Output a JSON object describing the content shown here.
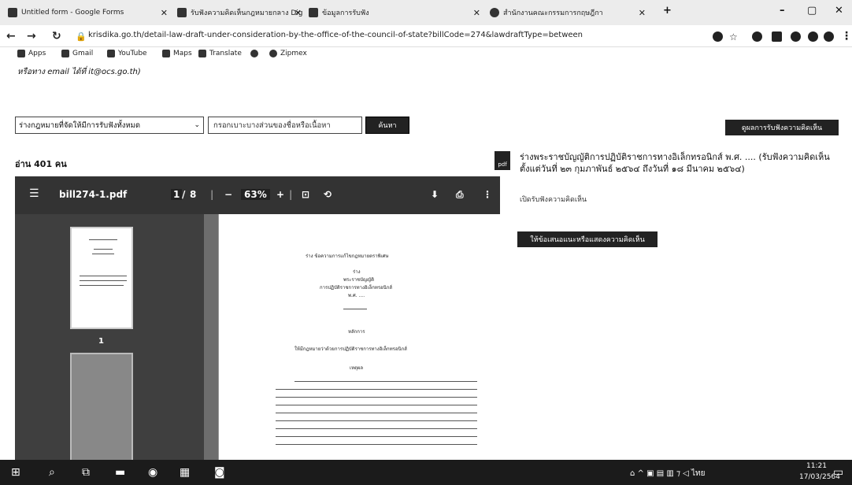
{
  "browser": {
    "tabs": [
      {
        "title": "Untitled form - Google Forms"
      },
      {
        "title": "รับฟังความคิดเห็นกฎหมายกลาง Digi"
      },
      {
        "title": "ข้อมูลการรับฟัง"
      },
      {
        "title": "สำนักงานคณะกรรมการกฤษฎีกา"
      }
    ],
    "new_tab": "+",
    "url": "krisdika.go.th/detail-law-draft-under-consideration-by-the-office-of-the-council-of-state?billCode=274&lawdraftType=between",
    "bookmarks": [
      "Apps",
      "Gmail",
      "YouTube",
      "Maps",
      "Translate",
      "Zipmex"
    ]
  },
  "page": {
    "email_line": "หรือทาง email ได้ที่ it@ocs.go.th)",
    "category_select": "ร่างกฎหมายที่จัดให้มีการรับฟังทั้งหมด",
    "search_placeholder": "กรอกเบาะบางส่วนของชื่อหรือเนื้อหา",
    "search_button": "ค้นหา",
    "top_right_button": "ดูผลการรับฟังความคิดเห็น",
    "read_count": "อ่าน 401 คน",
    "pdf": {
      "filename": "bill274-1.pdf",
      "page": "1",
      "page_sep": "/",
      "total_pages": "8",
      "zoom": "63%",
      "thumb_page": "1",
      "page_heading": "ร่าง ข้อความการแก้ไขกฎหมายตราพิเศษ",
      "page_sub1": "ร่าง",
      "page_sub2": "พระราชบัญญัติ",
      "page_sub3": "การปฏิบัติราชการทางอิเล็กทรอนิกส์",
      "page_sub4": "พ.ศ. ....",
      "page_section": "หลักการ",
      "page_principle": "ให้มีกฎหมายว่าด้วยการปฏิบัติราชการทางอิเล็กทรอนิกส์",
      "page_reason": "เหตุผล"
    },
    "doc_title": "ร่างพระราชบัญญัติการปฏิบัติราชการทางอิเล็กทรอนิกส์ พ.ศ. .... (รับฟังความคิดเห็นตั้งแต่วันที่ ๒๓ กุมภาพันธ์ ๒๕๖๔ ถึงวันที่ ๑๘ มีนาคม ๒๕๖๔)",
    "doc_sub": "เปิดรับฟังความคิดเห็น",
    "pdf_badge": "pdf",
    "opinion_button": "ให้ข้อเสนอแนะหรือแสดงความคิดเห็น"
  },
  "taskbar": {
    "tray": "ไทย",
    "time": "11:21",
    "date": "17/03/2564"
  }
}
